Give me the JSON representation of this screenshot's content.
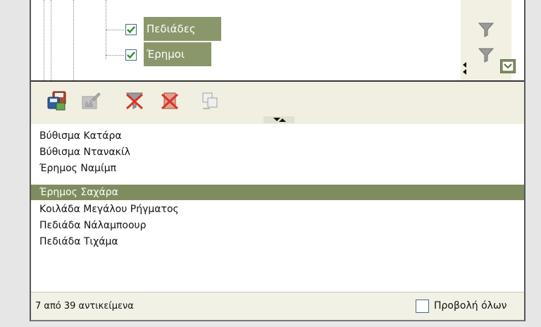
{
  "tree": {
    "items": [
      {
        "label": "Πεδιάδες",
        "checked": true
      },
      {
        "label": "Έρημοι",
        "checked": true
      }
    ]
  },
  "toolbar": {
    "icons": [
      "save-icon",
      "edit-icon",
      "clear-filter-icon",
      "delete-filter-icon",
      "copy-icon"
    ]
  },
  "list": {
    "items": [
      "Βύθισμα Κατάρα",
      "Βύθισμα Ντανακίλ",
      "Έρημος Ναμίμπ",
      "Έρημος Σαχάρα",
      "Κοιλάδα Μεγάλου Ρήγματος",
      "Πεδιάδα Νάλαμποουρ",
      "Πεδιάδα Τιχάμα"
    ],
    "selected_index": 3
  },
  "status": {
    "count_text": "7 από 39 αντικείμενα",
    "show_all_label": "Προβολή όλων",
    "show_all_checked": false
  },
  "colors": {
    "selection": "#7f8c5f",
    "node_highlight": "#8a976a",
    "toolbar_bg": "#f0efe1"
  }
}
